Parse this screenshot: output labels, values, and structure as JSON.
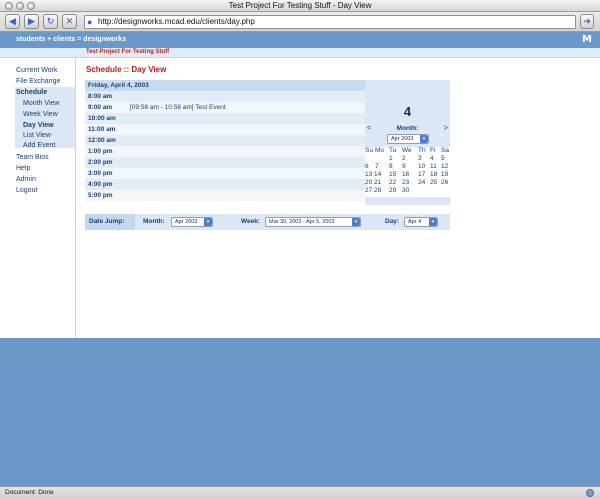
{
  "window": {
    "title": "Test Project For Testing Stuff - Day View"
  },
  "toolbar": {
    "url": "http://designworks.mcad.edu/clients/day.php"
  },
  "header": {
    "site_title": "students + clients = designworks",
    "logo_text": "M"
  },
  "project": {
    "label": "Test Project For Testing Stuff"
  },
  "nav": {
    "current_work": "Current Work",
    "file_exchange": "File Exchange",
    "schedule": "Schedule",
    "month_view": "Month View",
    "week_view": "Week View",
    "day_view": "Day View",
    "list_view": "List View",
    "add_event": "Add Event",
    "team_bios": "Team Bios",
    "help": "Help",
    "admin": "Admin",
    "logout": "Logout"
  },
  "page": {
    "heading": "Schedule :: Day View"
  },
  "schedule": {
    "date": "Friday, April 4, 2003",
    "times": [
      "8:00 am",
      "9:00 am",
      "10:00 am",
      "11:00 am",
      "12:00 am",
      "1:00 pm",
      "2:00 pm",
      "3:00 pm",
      "4:00 pm",
      "5:00 pm"
    ],
    "event": "[09:58 am - 10:58 am] Test Event"
  },
  "calendar": {
    "day_number": "4",
    "prev": "<",
    "next": ">",
    "month_label": "Month:",
    "month_select": "Apr 2003",
    "weekdays": [
      "Su",
      "Mo",
      "Tu",
      "We",
      "Th",
      "Fr",
      "Sa"
    ],
    "weeks": [
      [
        "",
        "",
        "1",
        "2",
        "3",
        "4",
        "5"
      ],
      [
        "6",
        "7",
        "8",
        "9",
        "10",
        "11",
        "12"
      ],
      [
        "13",
        "14",
        "15",
        "16",
        "17",
        "18",
        "19"
      ],
      [
        "20",
        "21",
        "22",
        "23",
        "24",
        "25",
        "26"
      ],
      [
        "27",
        "28",
        "29",
        "30",
        "",
        "",
        ""
      ]
    ]
  },
  "jump": {
    "title": "Date Jump:",
    "month_label": "Month:",
    "month_value": "Apr 2003",
    "week_label": "Week:",
    "week_value": "Mar 30, 2003 - Apr 5, 2003",
    "day_label": "Day:",
    "day_value": "Apr 4"
  },
  "status": {
    "text": "Document: Done"
  },
  "colors": {
    "header_blue": "#6a98c9",
    "heading_red": "#b82020",
    "panel_blue": "#dbe7f4"
  }
}
